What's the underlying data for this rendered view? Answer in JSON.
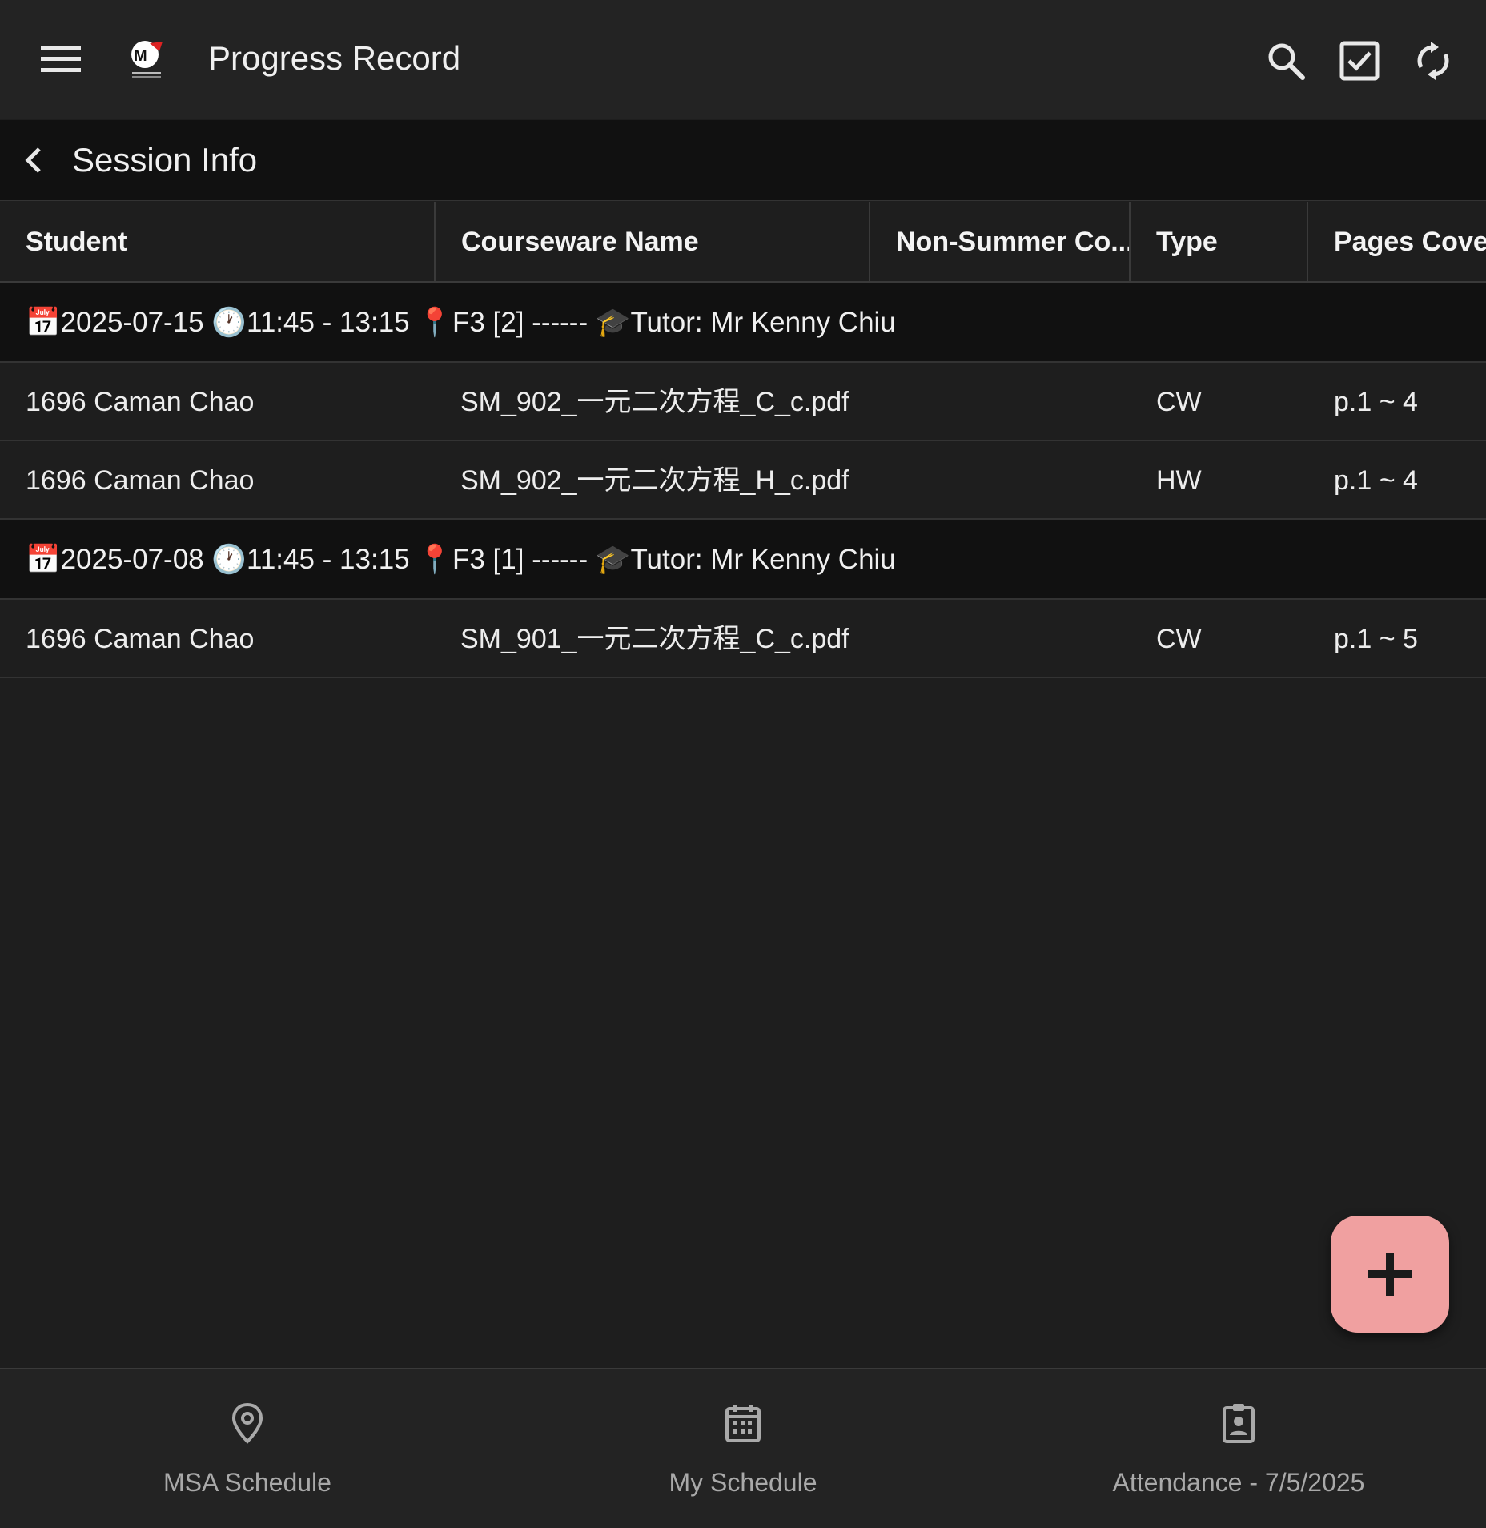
{
  "appbar": {
    "title": "Progress Record",
    "icons": [
      "menu-icon",
      "app-logo",
      "search-icon",
      "checkbox-icon",
      "sync-icon"
    ]
  },
  "subbar": {
    "title": "Session Info",
    "back_icon": "chevron-left-icon"
  },
  "table": {
    "columns": [
      "Student",
      "Courseware Name",
      "Non-Summer Co...",
      "Type",
      "Pages Cover"
    ],
    "groups": [
      {
        "header": {
          "date": "2025-07-15",
          "time": "11:45 - 13:15",
          "location": "F3 [2] ------",
          "tutor": "Tutor: Mr Kenny Chiu"
        },
        "rows": [
          {
            "student": "1696 Caman Chao",
            "courseware": "SM_902_一元二次方程_C_c.pdf",
            "non_summer": "",
            "type": "CW",
            "pages": "p.1 ~ 4"
          },
          {
            "student": "1696 Caman Chao",
            "courseware": "SM_902_一元二次方程_H_c.pdf",
            "non_summer": "",
            "type": "HW",
            "pages": "p.1 ~ 4"
          }
        ]
      },
      {
        "header": {
          "date": "2025-07-08",
          "time": "11:45 - 13:15",
          "location": "F3 [1] ------",
          "tutor": "Tutor: Mr Kenny Chiu"
        },
        "rows": [
          {
            "student": "1696 Caman Chao",
            "courseware": "SM_901_一元二次方程_C_c.pdf",
            "non_summer": "",
            "type": "CW",
            "pages": "p.1 ~ 5"
          }
        ]
      }
    ]
  },
  "fab": {
    "icon": "plus-icon",
    "color": "#f0a0a0"
  },
  "bottomnav": {
    "items": [
      {
        "label": "MSA Schedule",
        "icon": "location-pin-icon"
      },
      {
        "label": "My Schedule",
        "icon": "calendar-icon"
      },
      {
        "label": "Attendance - 7/5/2025",
        "icon": "clipboard-user-icon"
      }
    ]
  }
}
